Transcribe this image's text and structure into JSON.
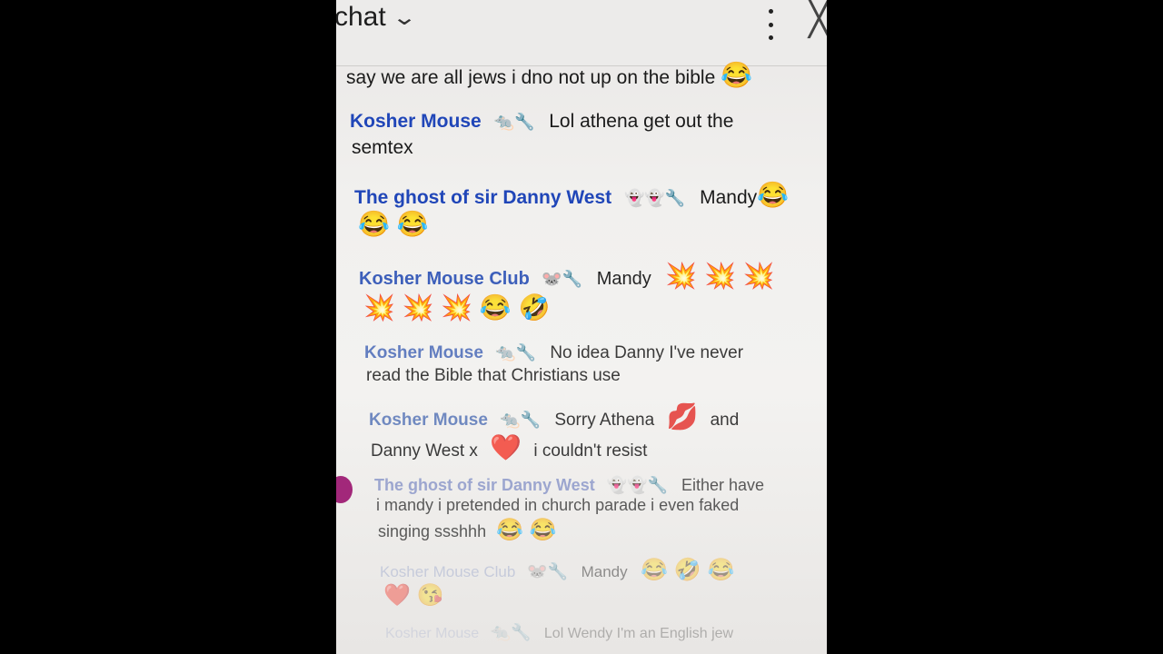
{
  "header": {
    "title": "chat",
    "chevron_icon": "chevron-down-icon",
    "menu_icon": "kebab-menu-icon",
    "close_icon": "close-icon"
  },
  "messages": [
    {
      "author": "",
      "badges": "",
      "text": "say we are all jews i dno not up on the bible",
      "emoji": "😂"
    },
    {
      "author": "Kosher Mouse",
      "badges": "🐀🔧",
      "text": "Lol athena get out the",
      "text2": "semtex"
    },
    {
      "author": "The ghost of sir Danny West",
      "badges": "👻👻🔧",
      "text": "Mandy",
      "emoji": "😂",
      "emoji2": "😂 😂"
    },
    {
      "author": "Kosher Mouse Club",
      "badges": "🐭🔧",
      "text": "Mandy",
      "emoji": "💥 💥 💥",
      "emoji2": "💥 💥 💥 😂 🤣"
    },
    {
      "author": "Kosher Mouse",
      "badges": "🐀🔧",
      "text": "No idea Danny I've never",
      "text2": "read the Bible that Christians use"
    },
    {
      "author": "Kosher Mouse",
      "badges": "🐀🔧",
      "text": "Sorry Athena",
      "emoji": "💋",
      "text_after": "and",
      "text2": "Danny West x",
      "emoji2": "❤️",
      "text2_after": "i couldn't resist"
    },
    {
      "author": "The ghost of sir Danny West",
      "badges": "👻👻🔧",
      "text": "Either have",
      "text2": "i mandy i pretended in church parade i even faked",
      "text3": "singing ssshhh",
      "emoji3": "😂 😂"
    },
    {
      "author": "Kosher Mouse Club",
      "badges": "🐭🔧",
      "text": "Mandy",
      "emoji": "😂 🤣 😂",
      "emoji2": "❤️ 😘"
    },
    {
      "author": "Kosher Mouse",
      "badges": "🐀🔧",
      "text": "Lol Wendy I'm an English jew"
    }
  ]
}
